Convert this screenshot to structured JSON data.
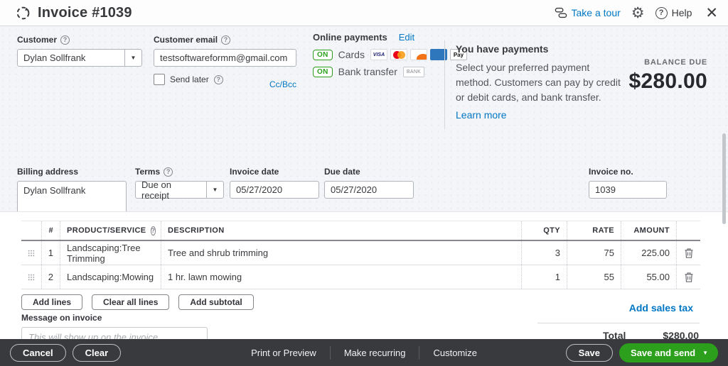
{
  "header": {
    "title": "Invoice #1039",
    "take_a_tour": "Take a tour",
    "help": "Help"
  },
  "icons": {
    "gear": "⚙",
    "close": "✕",
    "dropdown_arrow": "▼",
    "question": "?"
  },
  "customer": {
    "label": "Customer",
    "value": "Dylan Sollfrank",
    "email_label": "Customer email",
    "email_value": "testsoftwareformm@gmail.com",
    "send_later_label": "Send later",
    "ccbcc_link": "Cc/Bcc"
  },
  "online_payments": {
    "label": "Online payments",
    "edit_link": "Edit",
    "cards_label": "Cards",
    "bank_label": "Bank transfer",
    "on_badge": "ON",
    "visa_text": "VISA",
    "applepay_text": "Pay",
    "bank_chip_text": "BANK"
  },
  "payments_panel": {
    "title": "You have payments",
    "body": "Select your preferred payment method. Customers can pay by credit or debit cards, and bank transfer.",
    "learn_more": "Learn more"
  },
  "balance": {
    "label": "BALANCE DUE",
    "amount": "$280.00"
  },
  "details": {
    "billing_label": "Billing address",
    "billing_value": "Dylan Sollfrank",
    "terms_label": "Terms",
    "terms_value": "Due on receipt",
    "invoice_date_label": "Invoice date",
    "invoice_date_value": "05/27/2020",
    "due_date_label": "Due date",
    "due_date_value": "05/27/2020",
    "invoice_no_label": "Invoice no.",
    "invoice_no_value": "1039"
  },
  "table": {
    "headers": {
      "num": "#",
      "product": "PRODUCT/SERVICE",
      "description": "DESCRIPTION",
      "qty": "QTY",
      "rate": "RATE",
      "amount": "AMOUNT"
    },
    "rows": [
      {
        "num": "1",
        "product": "Landscaping:Tree Trimming",
        "description": "Tree and shrub trimming",
        "qty": "3",
        "rate": "75",
        "amount": "225.00"
      },
      {
        "num": "2",
        "product": "Landscaping:Mowing",
        "description": "1 hr. lawn mowing",
        "qty": "1",
        "rate": "55",
        "amount": "55.00"
      }
    ],
    "add_lines": "Add lines",
    "clear_all_lines": "Clear all lines",
    "add_subtotal": "Add subtotal"
  },
  "totals": {
    "add_sales_tax": "Add sales tax",
    "total_label": "Total",
    "total_value": "$280.00"
  },
  "message": {
    "label": "Message on invoice",
    "placeholder": "This will show up on the invoice."
  },
  "footer": {
    "cancel": "Cancel",
    "clear": "Clear",
    "print_or_preview": "Print or Preview",
    "make_recurring": "Make recurring",
    "customize": "Customize",
    "save": "Save",
    "save_and_send": "Save and send"
  },
  "colors": {
    "accent_green": "#2ca01c",
    "link_blue": "#0077c5",
    "footer_bg": "#393a3d",
    "page_bg": "#f4f5f8"
  }
}
